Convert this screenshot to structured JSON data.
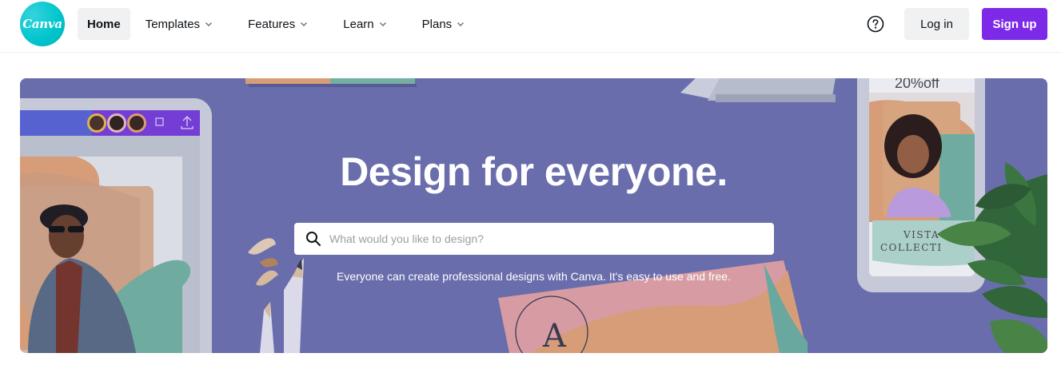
{
  "header": {
    "logo_text": "Canva",
    "nav": [
      {
        "label": "Home",
        "active": true,
        "has_menu": false
      },
      {
        "label": "Templates",
        "active": false,
        "has_menu": true
      },
      {
        "label": "Features",
        "active": false,
        "has_menu": true
      },
      {
        "label": "Learn",
        "active": false,
        "has_menu": true
      },
      {
        "label": "Plans",
        "active": false,
        "has_menu": true
      }
    ],
    "help_icon": "question-circle-icon",
    "login_label": "Log in",
    "signup_label": "Sign up"
  },
  "hero": {
    "title": "Design for everyone.",
    "search": {
      "placeholder": "What would you like to design?",
      "value": "",
      "icon": "search-icon"
    },
    "subtitle": "Everyone can create professional designs with Canva. It's easy to use and free.",
    "art": {
      "card_text": "VISTA\nCOLLECTI",
      "card_line1": "VISTA",
      "card_line2": "COLLECTI",
      "promo_text": "20%off",
      "monogram": "A"
    }
  },
  "colors": {
    "brand_teal": "#00c4cc",
    "signup_purple": "#7d2ae8",
    "hero_background": "#6f73b0",
    "button_gray": "#f0f1f3"
  }
}
